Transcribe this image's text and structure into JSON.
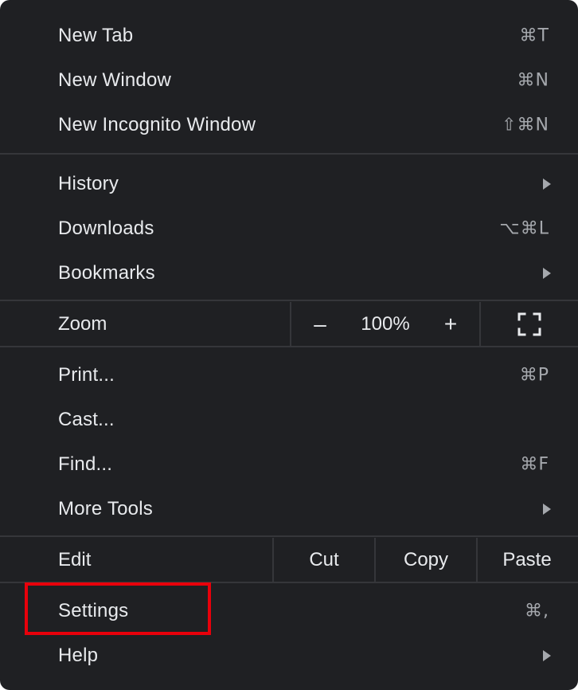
{
  "menu": {
    "group1": [
      {
        "label": "New Tab",
        "shortcut": "⌘T"
      },
      {
        "label": "New Window",
        "shortcut": "⌘N"
      },
      {
        "label": "New Incognito Window",
        "shortcut": "⇧⌘N"
      }
    ],
    "group2": [
      {
        "label": "History",
        "submenu": true
      },
      {
        "label": "Downloads",
        "shortcut": "⌥⌘L"
      },
      {
        "label": "Bookmarks",
        "submenu": true
      }
    ],
    "zoom": {
      "label": "Zoom",
      "minus": "–",
      "value": "100%",
      "plus": "+",
      "fullscreen_icon": "fullscreen-icon"
    },
    "group3": [
      {
        "label": "Print...",
        "shortcut": "⌘P"
      },
      {
        "label": "Cast..."
      },
      {
        "label": "Find...",
        "shortcut": "⌘F"
      },
      {
        "label": "More Tools",
        "submenu": true
      }
    ],
    "edit": {
      "label": "Edit",
      "cut": "Cut",
      "copy": "Copy",
      "paste": "Paste"
    },
    "group4": [
      {
        "label": "Settings",
        "shortcut": "⌘,"
      },
      {
        "label": "Help",
        "submenu": true
      }
    ]
  },
  "colors": {
    "background": "#1f2023",
    "text": "#e8eaed",
    "shortcut": "#a5a8ad",
    "divider": "#35363a",
    "highlight_box": "#e8000b"
  }
}
